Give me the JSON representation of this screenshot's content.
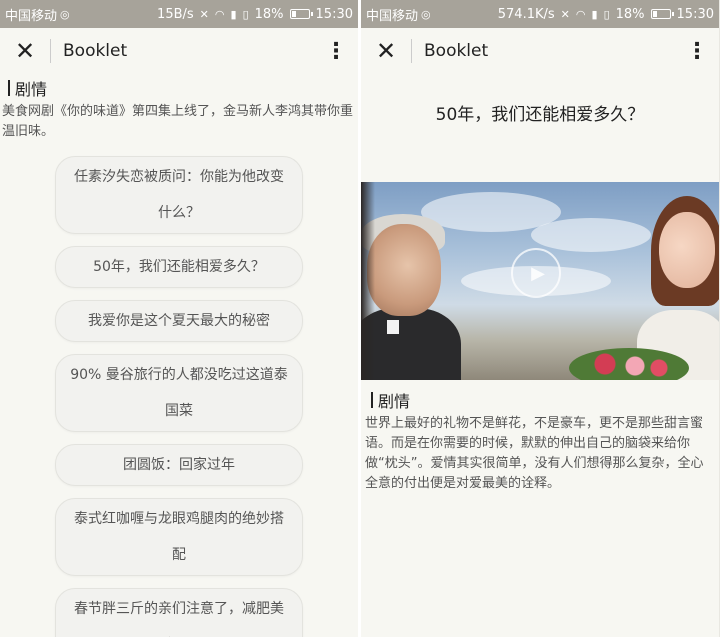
{
  "left_phone": {
    "status": {
      "carrier": "中国移动",
      "speed": "15B/s",
      "battery": "18%",
      "time": "15:30"
    },
    "appbar": {
      "close": "✕",
      "title": "Booklet",
      "menu": "⋮"
    },
    "section": "剧情",
    "intro": "美食网剧《你的味道》第四集上线了，金马新人李鸿其带你重温旧味。",
    "items": [
      "任素汐失恋被质问：你能为他改变什么？",
      "50年，我们还能相爱多久？",
      "我爱你是这个夏天最大的秘密",
      "90% 曼谷旅行的人都没吃过这道泰国菜",
      "团圆饭：回家过年",
      "泰式红咖喱与龙眼鸡腿肉的绝妙搭配",
      "春节胖三斤的亲们注意了，减肥美食到!"
    ]
  },
  "right_phone": {
    "status": {
      "carrier": "中国移动",
      "speed": "574.1K/s",
      "battery": "18%",
      "time": "15:30"
    },
    "appbar": {
      "close": "✕",
      "title": "Booklet",
      "menu": "⋮"
    },
    "article_title": "50年，我们还能相爱多久？",
    "section": "剧情",
    "body": "世界上最好的礼物不是鲜花，不是豪车，更不是那些甜言蜜语。而是在你需要的时候，默默的伸出自己的脑袋来给你做“枕头”。爱情其实很简单，没有人们想得那么复杂，全心全意的付出便是对爱最美的诠释。"
  },
  "icons": {
    "close": "close-icon",
    "menu": "more-vertical-icon",
    "play": "play-icon",
    "wifi": "wifi-icon",
    "battery": "battery-icon"
  }
}
